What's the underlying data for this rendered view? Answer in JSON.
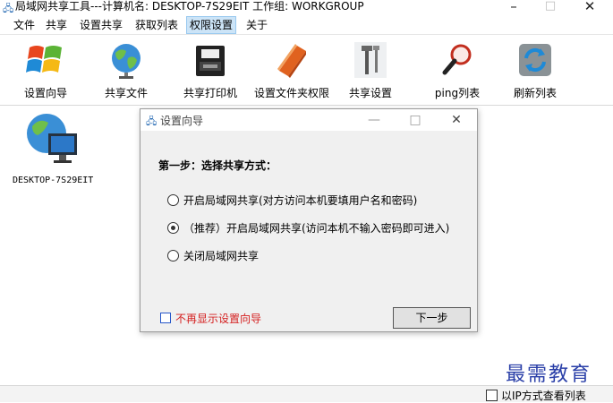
{
  "window": {
    "title": "局域网共享工具---计算机名: DESKTOP-7S29EIT  工作组: WORKGROUP",
    "minimize": "–",
    "maximize": "□",
    "close": "✕"
  },
  "menu": [
    "文件",
    "共享",
    "设置共享",
    "获取列表",
    "权限设置",
    "关于"
  ],
  "toolbar": {
    "items": [
      {
        "label": "设置向导",
        "icon": "windows-logo-icon"
      },
      {
        "label": "共享文件",
        "icon": "globe-icon"
      },
      {
        "label": "共享打印机",
        "icon": "printer-icon"
      },
      {
        "label": "设置文件夹权限",
        "icon": "folder-book-icon"
      },
      {
        "label": "共享设置",
        "icon": "tools-icon"
      },
      {
        "label": "ping列表",
        "icon": "magnifier-icon"
      },
      {
        "label": "刷新列表",
        "icon": "refresh-icon"
      }
    ]
  },
  "hosts": [
    {
      "name": "DESKTOP-7S29EIT",
      "icon": "computer-globe-icon"
    }
  ],
  "dialog": {
    "title": "设置向导",
    "heading": "第一步：选择共享方式：",
    "options": [
      {
        "label": "开启局域网共享(对方访问本机要填用户名和密码)",
        "checked": false
      },
      {
        "label": "（推荐）开启局域网共享(访问本机不输入密码即可进入)",
        "checked": true
      },
      {
        "label": "关闭局域网共享",
        "checked": false
      }
    ],
    "dont_show_label": "不再显示设置向导",
    "next_label": "下一步",
    "minimize": "—",
    "maximize": "□",
    "close": "✕"
  },
  "statusbar": {
    "ip_list_label": "以IP方式查看列表"
  },
  "watermark": "最需教育",
  "colors": {
    "accent": "#2a6db5",
    "menu_active": "#cce4f7",
    "warning_text": "#d42020",
    "watermark": "#2a3fa8"
  }
}
